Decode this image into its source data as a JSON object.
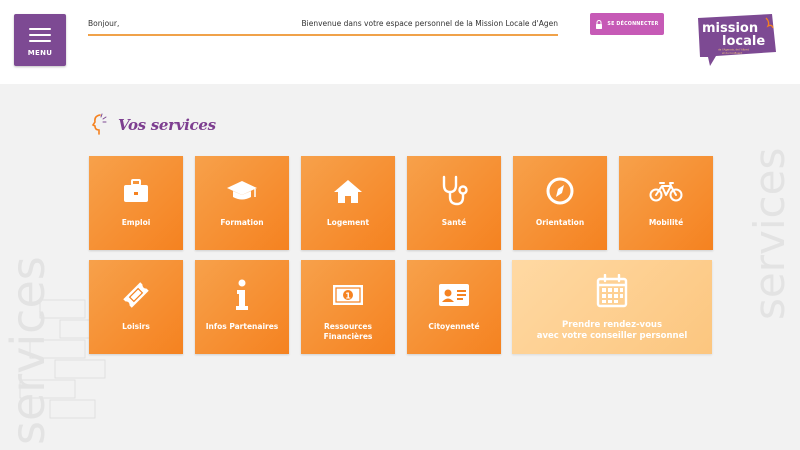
{
  "header": {
    "menu_label": "MENU",
    "greeting": "Bonjour,",
    "welcome": "Bienvenue dans votre espace personnel de la Mission Locale d'Agen",
    "logout_label": "SE DÉCONNECTER"
  },
  "logo": {
    "line1": "mission",
    "line2": "locale",
    "tagline1": "de l'Agenais, de l'Albret",
    "tagline2": "et du Confluent"
  },
  "services": {
    "title": "Vos services",
    "tiles": [
      {
        "label": "Emploi",
        "icon": "briefcase-icon"
      },
      {
        "label": "Formation",
        "icon": "graduation-cap-icon"
      },
      {
        "label": "Logement",
        "icon": "home-icon"
      },
      {
        "label": "Santé",
        "icon": "stethoscope-icon"
      },
      {
        "label": "Orientation",
        "icon": "compass-icon"
      },
      {
        "label": "Mobilité",
        "icon": "bicycle-icon"
      },
      {
        "label": "Loisirs",
        "icon": "ticket-icon"
      },
      {
        "label": "Infos Partenaires",
        "icon": "info-icon"
      },
      {
        "label": "Ressources Financières",
        "label_line1": "Ressources",
        "label_line2": "Financières",
        "icon": "banknote-icon"
      },
      {
        "label": "Citoyenneté",
        "icon": "id-card-icon"
      }
    ],
    "appointment": {
      "line1": "Prendre rendez-vous",
      "line2": "avec votre conseiller personnel",
      "icon": "calendar-icon"
    }
  },
  "watermark": "services",
  "colors": {
    "purple": "#7d4a93",
    "orange": "#f58220",
    "pink": "#c65ab6",
    "light_orange": "#fcc67f"
  }
}
